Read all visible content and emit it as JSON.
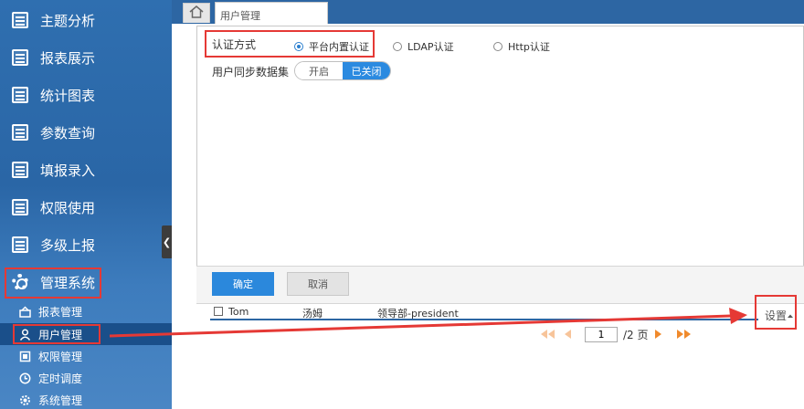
{
  "sidebar": {
    "nav": [
      {
        "label": "主题分析",
        "icon": "document-icon"
      },
      {
        "label": "报表展示",
        "icon": "document-icon"
      },
      {
        "label": "统计图表",
        "icon": "document-icon"
      },
      {
        "label": "参数查询",
        "icon": "document-icon"
      },
      {
        "label": "填报录入",
        "icon": "document-icon"
      },
      {
        "label": "权限使用",
        "icon": "document-icon"
      },
      {
        "label": "多级上报",
        "icon": "document-icon"
      },
      {
        "label": "管理系统",
        "icon": "gear-icon"
      }
    ],
    "sub": [
      {
        "label": "报表管理",
        "icon": "report-icon"
      },
      {
        "label": "用户管理",
        "icon": "user-icon"
      },
      {
        "label": "权限管理",
        "icon": "permission-icon"
      },
      {
        "label": "定时调度",
        "icon": "clock-icon"
      },
      {
        "label": "系统管理",
        "icon": "gear-icon"
      }
    ],
    "collapse_glyph": "❮"
  },
  "tabs": {
    "active_label": "用户管理"
  },
  "auth": {
    "label": "认证方式",
    "options": [
      "平台内置认证",
      "LDAP认证",
      "Http认证"
    ],
    "selected": "平台内置认证"
  },
  "sync": {
    "label": "用户同步数据集",
    "off_label": "开启",
    "on_label": "已关闭"
  },
  "buttons": {
    "ok": "确定",
    "cancel": "取消"
  },
  "table": {
    "row": {
      "username": "Tom",
      "realname": "汤姆",
      "department": "领导部-president"
    }
  },
  "settings_label": "设置",
  "pager": {
    "current_page": "1",
    "total_label": "/2 页"
  },
  "colors": {
    "sidebar": "#2f6fb0",
    "accent": "#2b88dc",
    "highlight": "#e53935",
    "pager_arrow": "#f08a2c"
  }
}
